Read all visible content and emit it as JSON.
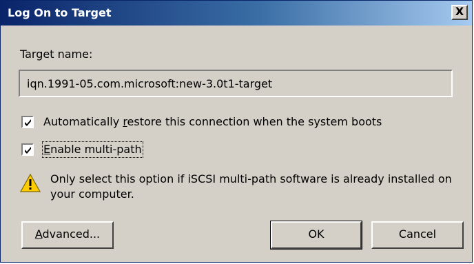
{
  "window": {
    "title": "Log On to Target",
    "close_label": "X"
  },
  "target": {
    "label": "Target name:",
    "value": "iqn.1991-05.com.microsoft:new-3.0t1-target"
  },
  "options": {
    "auto_restore": {
      "label_before": "Automatically ",
      "label_mnemonic": "r",
      "label_after": "estore this connection when the system boots",
      "checked": true
    },
    "multipath": {
      "label_mnemonic": "E",
      "label_after": "nable multi-path",
      "checked": true
    }
  },
  "warning": {
    "icon": "warning-icon",
    "text": "Only select this option if iSCSI multi-path software is already installed on your computer."
  },
  "buttons": {
    "advanced_mnemonic": "A",
    "advanced_after": "dvanced...",
    "ok": "OK",
    "cancel": "Cancel"
  },
  "colors": {
    "title_gradient_start": "#0a246a",
    "title_gradient_end": "#a6caf0",
    "face": "#d4d0c8",
    "warning_yellow": "#ffcc00"
  }
}
